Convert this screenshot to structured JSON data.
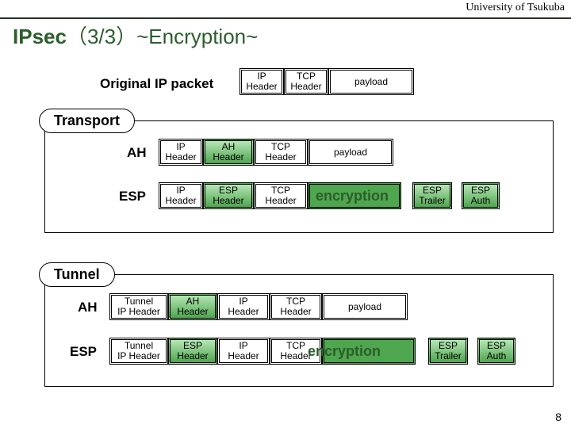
{
  "univ": "University of Tsukuba",
  "title": {
    "ipsec": "IPsec",
    "paren": "（3/3）",
    "sub": "~Encryption~"
  },
  "labels": {
    "original_ip_packet": "Original  IP packet",
    "transport": "Transport",
    "tunnel": "Tunnel",
    "ah": "AH",
    "esp": "ESP",
    "encryption": "encryption"
  },
  "fields": {
    "ip_header": "IP\nHeader",
    "tcp_header": "TCP\nHeader",
    "payload": "payload",
    "ah_header": "AH\nHeader",
    "esp_header": "ESP\nHeader",
    "esp_trailer": "ESP\nTrailer",
    "esp_auth": "ESP\nAuth",
    "tunnel_ip_header": "Tunnel\nIP Header"
  },
  "page_number": "8"
}
